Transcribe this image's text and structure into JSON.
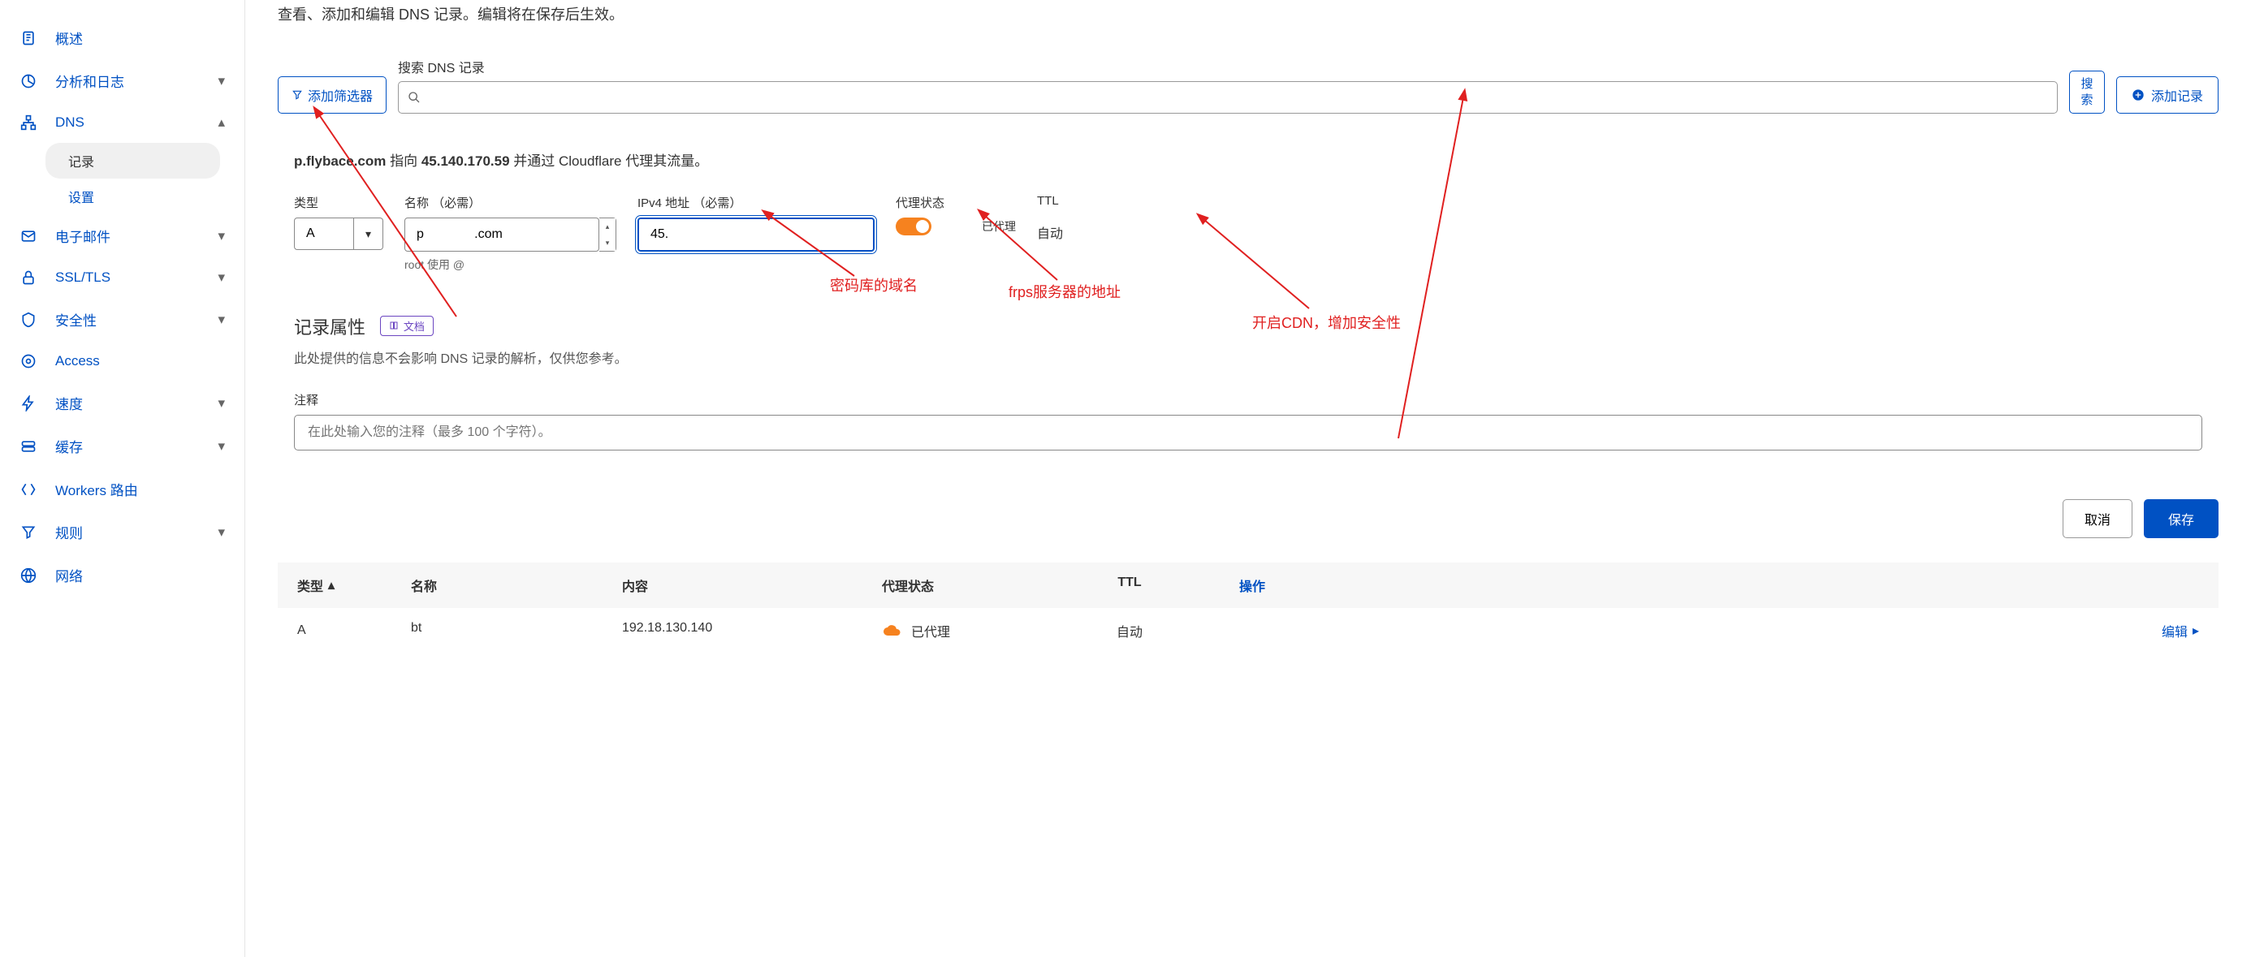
{
  "sidebar": {
    "items": [
      {
        "label": "概述"
      },
      {
        "label": "分析和日志"
      },
      {
        "label": "DNS"
      },
      {
        "label": "电子邮件"
      },
      {
        "label": "SSL/TLS"
      },
      {
        "label": "安全性"
      },
      {
        "label": "Access"
      },
      {
        "label": "速度"
      },
      {
        "label": "缓存"
      },
      {
        "label": "Workers 路由"
      },
      {
        "label": "规则"
      },
      {
        "label": "网络"
      }
    ],
    "dns_sub": [
      {
        "label": "记录"
      },
      {
        "label": "设置"
      }
    ]
  },
  "page": {
    "description": "查看、添加和编辑 DNS 记录。编辑将在保存后生效。",
    "search_label": "搜索 DNS 记录",
    "filter_btn": "添加筛选器",
    "search_btn": "搜索",
    "add_btn": "添加记录"
  },
  "record": {
    "summary_pre": "p.flybace.com",
    "summary_mid": " 指向 ",
    "summary_ip": "45.140.170.59",
    "summary_post": " 并通过 Cloudflare 代理其流量。",
    "type_label": "类型",
    "type_value": "A",
    "name_label": "名称 （必需）",
    "name_value": "p              .com",
    "name_hint": "root 使用 @",
    "ipv4_label": "IPv4 地址 （必需）",
    "ipv4_value": "45.",
    "proxy_label": "代理状态",
    "proxy_status": "已代理",
    "ttl_label": "TTL",
    "ttl_value": "自动"
  },
  "attrs": {
    "title": "记录属性",
    "docs": "文档",
    "desc": "此处提供的信息不会影响 DNS 记录的解析，仅供您参考。",
    "comment_label": "注释",
    "comment_placeholder": "在此处输入您的注释（最多 100 个字符）。"
  },
  "actions": {
    "cancel": "取消",
    "save": "保存"
  },
  "table": {
    "headers": {
      "type": "类型",
      "name": "名称",
      "content": "内容",
      "proxy": "代理状态",
      "ttl": "TTL",
      "action": "操作"
    },
    "rows": [
      {
        "type": "A",
        "name": "bt",
        "content": "192.18.130.140",
        "proxy": "已代理",
        "ttl": "自动",
        "action": "编辑"
      }
    ]
  },
  "annotations": {
    "a1": "密码库的域名",
    "a2": "frps服务器的地址",
    "a3": "开启CDN，增加安全性"
  }
}
